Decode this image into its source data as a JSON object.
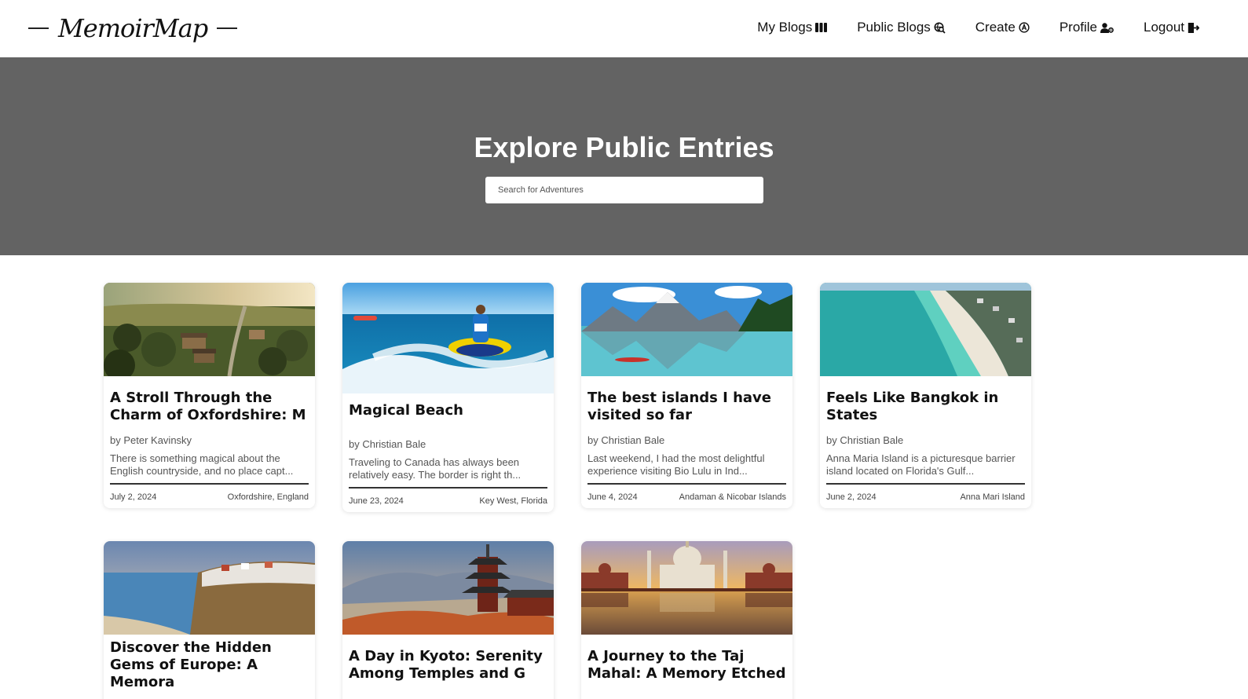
{
  "header": {
    "logo": "MemoirMap",
    "nav": [
      {
        "label": "My Blogs",
        "icon": "grid-columns-icon"
      },
      {
        "label": "Public Blogs",
        "icon": "globe-search-icon"
      },
      {
        "label": "Create",
        "icon": "create-circle-icon"
      },
      {
        "label": "Profile",
        "icon": "user-gear-icon"
      },
      {
        "label": "Logout",
        "icon": "logout-icon"
      }
    ]
  },
  "hero": {
    "title": "Explore Public Entries",
    "search_placeholder": "Search for Adventures"
  },
  "cards": [
    {
      "title": "A Stroll Through the Charm of Oxfordshire: M",
      "author": "by Peter Kavinsky",
      "excerpt": "There is something magical about the English countryside, and no place capt...",
      "date": "July 2, 2024",
      "location": "Oxfordshire, England",
      "image": "countryside-village-aerial"
    },
    {
      "title": "Magical Beach",
      "author": "by Christian Bale",
      "excerpt": "Traveling to Canada has always been relatively easy. The border is right th...",
      "date": "June 23, 2024",
      "location": "Key West, Florida",
      "image": "jet-ski-ocean"
    },
    {
      "title": "The best islands I have visited so far",
      "author": "by Christian Bale",
      "excerpt": "Last weekend, I had the most delightful experience visiting Bio Lulu in Ind...",
      "date": "June 4, 2024",
      "location": "Andaman & Nicobar Islands",
      "image": "mountain-lake-kayak"
    },
    {
      "title": "Feels Like Bangkok in States",
      "author": "by Christian Bale",
      "excerpt": "Anna Maria Island is a picturesque barrier island located on Florida's Gulf...",
      "date": "June 2, 2024",
      "location": "Anna Mari Island",
      "image": "beach-aerial"
    },
    {
      "title": "Discover the Hidden Gems of Europe: A Memora",
      "image": "cliffside-town-coast"
    },
    {
      "title": "A Day in Kyoto: Serenity Among Temples and G",
      "image": "kyoto-pagoda"
    },
    {
      "title": "A Journey to the Taj Mahal: A Memory Etched",
      "image": "taj-mahal-sunset"
    }
  ]
}
